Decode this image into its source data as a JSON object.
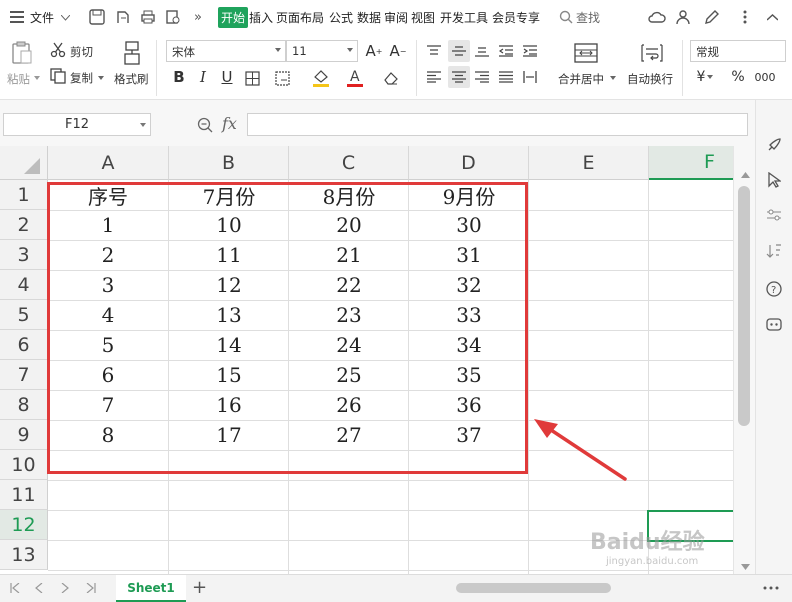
{
  "menubar": {
    "file_label": "文件",
    "tabs": [
      "开始",
      "插入",
      "页面布局",
      "公式",
      "数据",
      "审阅",
      "视图",
      "开发工具",
      "会员专享"
    ],
    "search_label": "查找"
  },
  "ribbon": {
    "paste_label": "粘贴",
    "cut_label": "剪切",
    "copy_label": "复制",
    "format_painter_label": "格式刷",
    "font_name": "宋体",
    "font_size": "11",
    "merge_center_label": "合并居中",
    "wrap_text_label": "自动换行",
    "number_format": "常规",
    "currency_symbol": "¥",
    "percent_symbol": "%",
    "thousands_symbol": "000"
  },
  "formula_bar": {
    "name_box": "F12",
    "fx_label": "fx",
    "formula_value": ""
  },
  "sheet": {
    "columns": [
      "A",
      "B",
      "C",
      "D",
      "E",
      "F"
    ],
    "selected_column": "F",
    "rows": [
      "1",
      "2",
      "3",
      "4",
      "5",
      "6",
      "7",
      "8",
      "9",
      "10",
      "11",
      "12",
      "13"
    ],
    "selected_row": "12",
    "cells": [
      [
        "序号",
        "7月份",
        "8月份",
        "9月份"
      ],
      [
        "1",
        "10",
        "20",
        "30"
      ],
      [
        "2",
        "11",
        "21",
        "31"
      ],
      [
        "3",
        "12",
        "22",
        "32"
      ],
      [
        "4",
        "13",
        "23",
        "33"
      ],
      [
        "5",
        "14",
        "24",
        "34"
      ],
      [
        "6",
        "15",
        "25",
        "35"
      ],
      [
        "7",
        "16",
        "26",
        "36"
      ],
      [
        "8",
        "17",
        "27",
        "37"
      ]
    ],
    "highlight_color": "#e03a3a",
    "accent_color": "#1e9b54"
  },
  "tabbar": {
    "sheet_tabs": [
      "Sheet1"
    ],
    "add_label": "+"
  },
  "watermark": {
    "line1": "Baidu经验",
    "line2": "jingyan.baidu.com"
  }
}
